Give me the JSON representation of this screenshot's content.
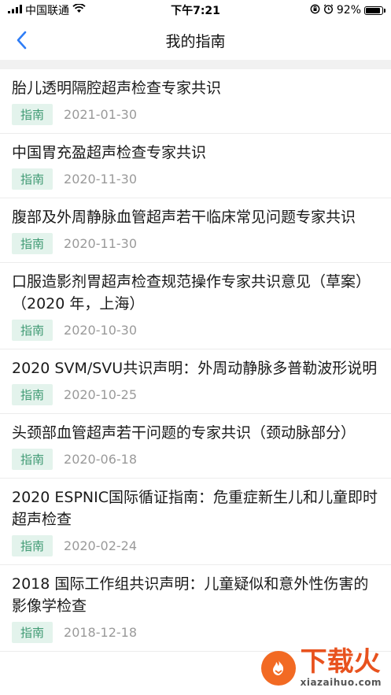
{
  "status_bar": {
    "carrier": "中国联通",
    "time": "下午7:21",
    "battery": "92%",
    "battery_level": 0.92
  },
  "nav": {
    "title": "我的指南"
  },
  "items": [
    {
      "title": "胎儿透明隔腔超声检查专家共识",
      "tag": "指南",
      "date": "2021-01-30"
    },
    {
      "title": "中国胃充盈超声检查专家共识",
      "tag": "指南",
      "date": "2020-11-30"
    },
    {
      "title": "腹部及外周静脉血管超声若干临床常见问题专家共识",
      "tag": "指南",
      "date": "2020-11-30"
    },
    {
      "title": "口服造影剂胃超声检查规范操作专家共识意见（草案）（2020 年，上海）",
      "tag": "指南",
      "date": "2020-10-30"
    },
    {
      "title": "2020 SVM/SVU共识声明：外周动静脉多普勒波形说明",
      "tag": "指南",
      "date": "2020-10-25"
    },
    {
      "title": "头颈部血管超声若干问题的专家共识（颈动脉部分）",
      "tag": "指南",
      "date": "2020-06-18"
    },
    {
      "title": "2020 ESPNIC国际循证指南：危重症新生儿和儿童即时超声检查",
      "tag": "指南",
      "date": "2020-02-24"
    },
    {
      "title": "2018 国际工作组共识声明：儿童疑似和意外性伤害的影像学检查",
      "tag": "指南",
      "date": "2018-12-18"
    }
  ],
  "watermark": {
    "main": "下载火",
    "sub": "xiazaihuo.com"
  }
}
